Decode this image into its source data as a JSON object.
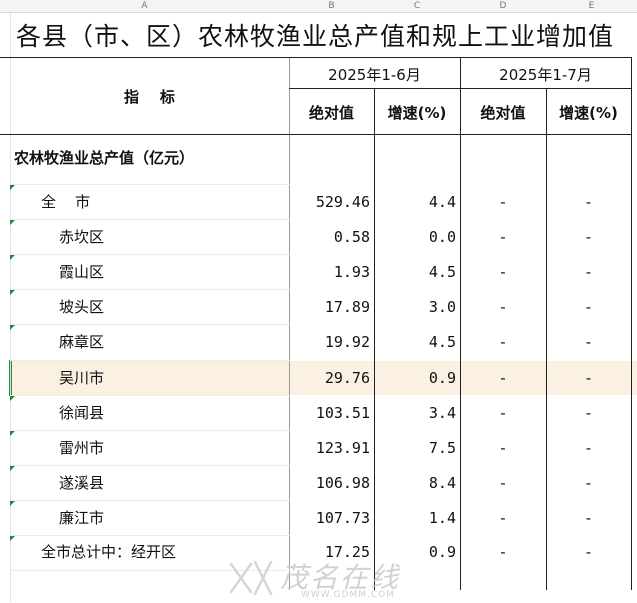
{
  "columns": [
    "A",
    "B",
    "C",
    "D",
    "E"
  ],
  "title": "各县（市、区）农林牧渔业总产值和规上工业增加值",
  "header": {
    "indicator": "指    标",
    "period1": "2025年1-6月",
    "period2": "2025年1-7月",
    "abs": "绝对值",
    "growth": "增速(%)"
  },
  "section_label": "农林牧渔业总产值（亿元）",
  "rows": [
    {
      "name": "全    市",
      "abs": "529.46",
      "growth": "4.4",
      "abs2": "-",
      "growth2": "-"
    },
    {
      "name": "赤坎区",
      "abs": "0.58",
      "growth": "0.0",
      "abs2": "-",
      "growth2": "-"
    },
    {
      "name": "霞山区",
      "abs": "1.93",
      "growth": "4.5",
      "abs2": "-",
      "growth2": "-"
    },
    {
      "name": "坡头区",
      "abs": "17.89",
      "growth": "3.0",
      "abs2": "-",
      "growth2": "-"
    },
    {
      "name": "麻章区",
      "abs": "19.92",
      "growth": "4.5",
      "abs2": "-",
      "growth2": "-"
    },
    {
      "name": "吴川市",
      "abs": "29.76",
      "growth": "0.9",
      "abs2": "-",
      "growth2": "-"
    },
    {
      "name": "徐闻县",
      "abs": "103.51",
      "growth": "3.4",
      "abs2": "-",
      "growth2": "-"
    },
    {
      "name": "雷州市",
      "abs": "123.91",
      "growth": "7.5",
      "abs2": "-",
      "growth2": "-"
    },
    {
      "name": "遂溪县",
      "abs": "106.98",
      "growth": "8.4",
      "abs2": "-",
      "growth2": "-"
    },
    {
      "name": "廉江市",
      "abs": "107.73",
      "growth": "1.4",
      "abs2": "-",
      "growth2": "-"
    },
    {
      "name": "全市总计中：经开区",
      "abs": "17.25",
      "growth": "0.9",
      "abs2": "-",
      "growth2": "-"
    }
  ],
  "watermark": {
    "text": "茂名在线",
    "url": "WWW.GDMM.COM"
  },
  "colors": {
    "highlight": "#fbf1e2",
    "marker": "#1f8a3b",
    "grid": "#d9d9d9"
  }
}
